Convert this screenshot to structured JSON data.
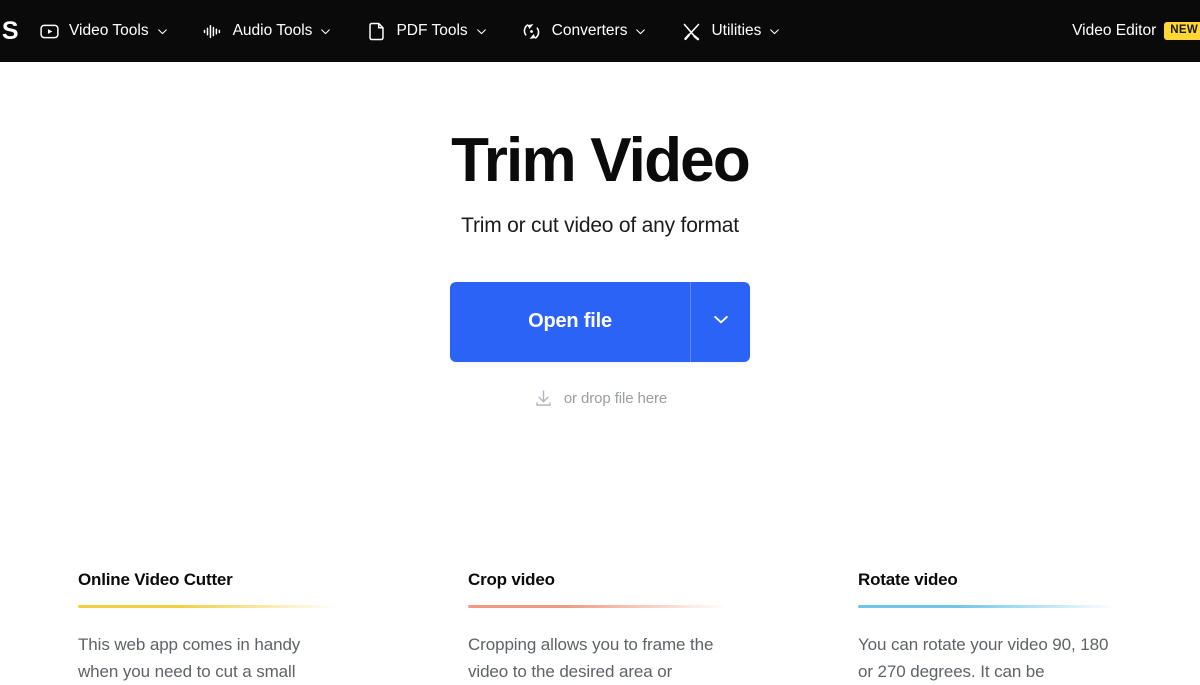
{
  "header": {
    "logo_text": "S",
    "nav_items": [
      {
        "label": "Video Tools",
        "icon": "video-play-icon",
        "chevron": "chevron-down-icon"
      },
      {
        "label": "Audio Tools",
        "icon": "audio-waveform-icon",
        "chevron": "chevron-down-icon"
      },
      {
        "label": "PDF Tools",
        "icon": "document-page-icon",
        "chevron": "chevron-down-icon"
      },
      {
        "label": "Converters",
        "icon": "convert-arrows-icon",
        "chevron": "chevron-down-icon"
      },
      {
        "label": "Utilities",
        "icon": "tools-cross-icon",
        "chevron": "chevron-down-icon"
      }
    ],
    "video_editor_label": "Video Editor",
    "new_badge": "NEW",
    "bg_color": "#0a0a0a",
    "badge_color": "#ffd633"
  },
  "hero": {
    "title": "Trim Video",
    "subtitle": "Trim or cut video of any format",
    "open_file_label": "Open file",
    "open_file_chevron": "chevron-down-icon",
    "drop_text": "or drop file here",
    "drop_icon": "download-arrow-icon",
    "button_color": "#2b63f6"
  },
  "cards": [
    {
      "title": "Online Video Cutter",
      "body": "This web app comes in handy when you need to cut a small",
      "accent": "#f2cf3e"
    },
    {
      "title": "Crop video",
      "body": "Cropping allows you to frame the video to the desired area or",
      "accent": "#ef9b84"
    },
    {
      "title": "Rotate video",
      "body": "You can rotate your video 90, 180 or 270 degrees. It can be",
      "accent": "#6ec6e8"
    }
  ]
}
